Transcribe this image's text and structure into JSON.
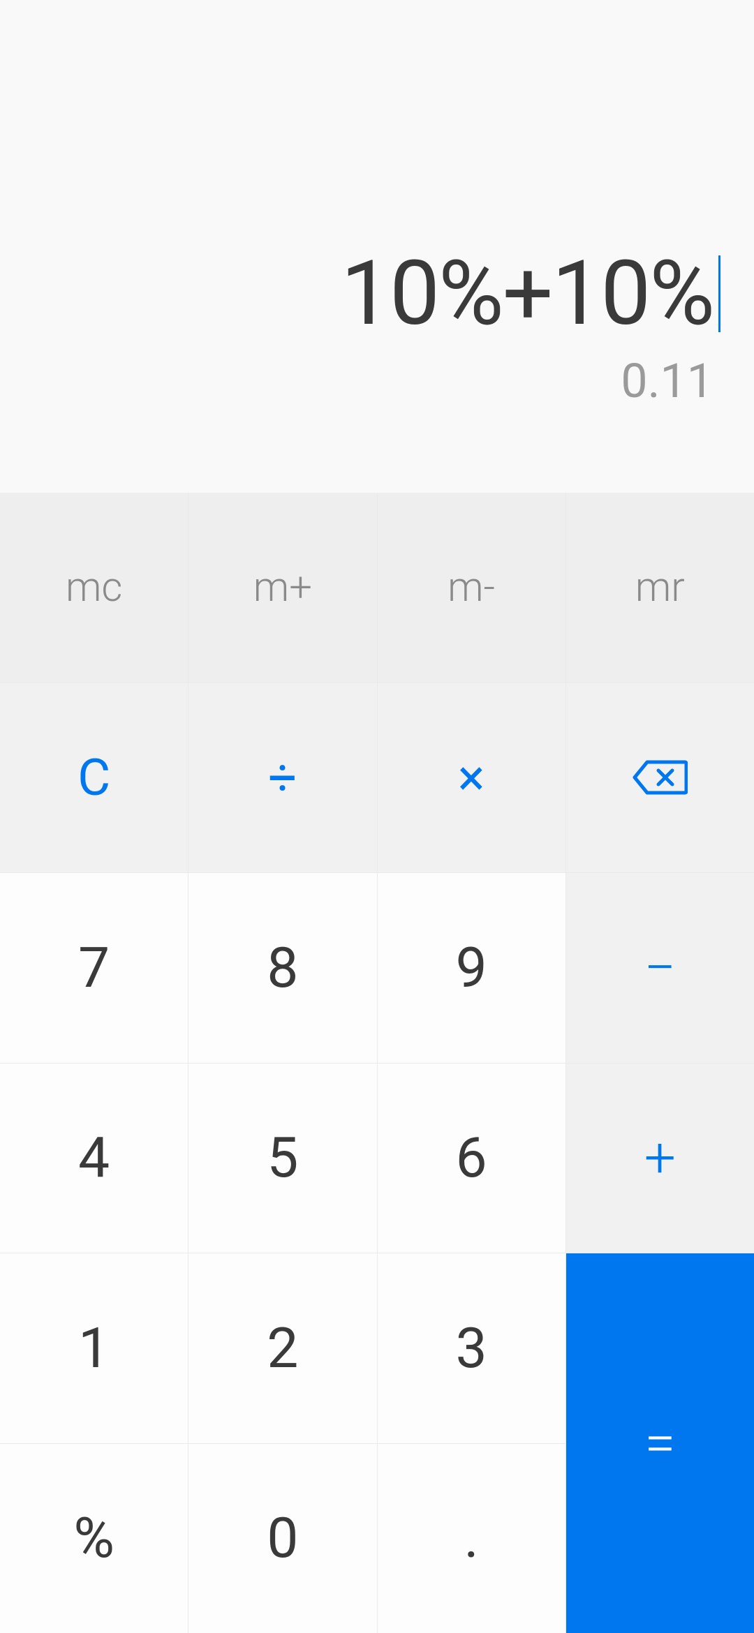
{
  "display": {
    "expression": "10%+10%",
    "result": "0.11"
  },
  "memory": {
    "mc": "mc",
    "m_plus": "m+",
    "m_minus": "m-",
    "mr": "mr"
  },
  "functions": {
    "clear": "C",
    "divide": "÷",
    "multiply": "×"
  },
  "operators": {
    "minus": "−",
    "plus": "+",
    "equals": "="
  },
  "digits": {
    "d7": "7",
    "d8": "8",
    "d9": "9",
    "d4": "4",
    "d5": "5",
    "d6": "6",
    "d1": "1",
    "d2": "2",
    "d3": "3",
    "d0": "0",
    "percent": "%",
    "decimal": "."
  },
  "colors": {
    "accent": "#0077ee",
    "digit_text": "#3a3a3a",
    "muted_text": "#9a9a9a",
    "mem_bg": "#eeeeee",
    "func_bg": "#f1f1f1",
    "num_bg": "#fdfdfd"
  }
}
